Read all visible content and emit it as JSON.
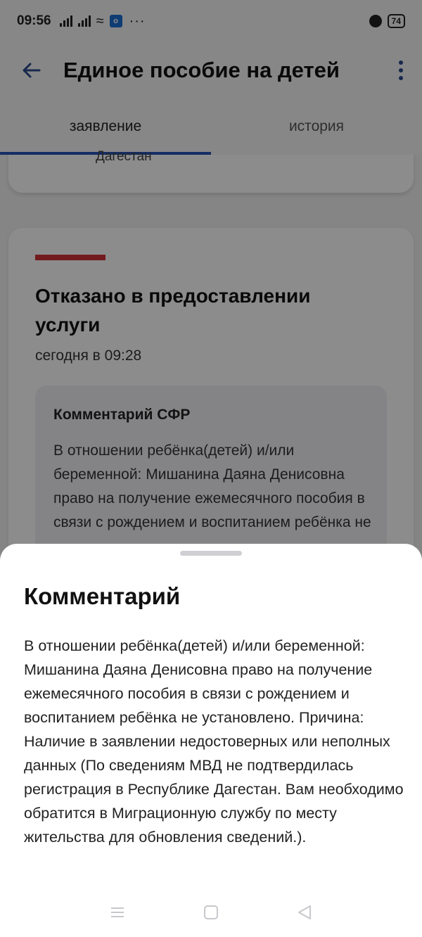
{
  "status_bar": {
    "time": "09:56",
    "notification_dots": "···",
    "battery": "74"
  },
  "app_bar": {
    "title": "Единое пособие на детей"
  },
  "tabs": [
    {
      "label": "заявление",
      "active": true
    },
    {
      "label": "история",
      "active": false
    }
  ],
  "background": {
    "region_tail": "Дагестан",
    "status_title": "Отказано в предоставлении услуги",
    "status_time": "сегодня в 09:28",
    "comment_box_title": "Комментарий СФР",
    "comment_box_text": "В отношении ребёнка(детей) и/или беременной: Мишанина Даяна Денисовна право на получение ежемесячного пособия в связи с рождением и воспитанием ребёнка не"
  },
  "sheet": {
    "title": "Комментарий",
    "text": "В отношении ребёнка(детей) и/или беременной: Мишанина Даяна Денисовна право на получение ежемесячного пособия в связи с рождением и воспитанием ребёнка не установлено. Причина: Наличие в заявлении недостоверных или неполных данных (По сведениям МВД не подтвердилась регистрация в Республике Дагестан. Вам необходимо обратится в Миграционную службу по месту жительства для обновления сведений.)."
  },
  "colors": {
    "accent": "#2552b8",
    "status_red": "#d0323a"
  },
  "icons": {
    "back": "arrow-left-icon",
    "more": "more-vert-icon",
    "nav_menu": "menu-icon",
    "nav_home": "square-icon",
    "nav_back": "triangle-back-icon"
  }
}
